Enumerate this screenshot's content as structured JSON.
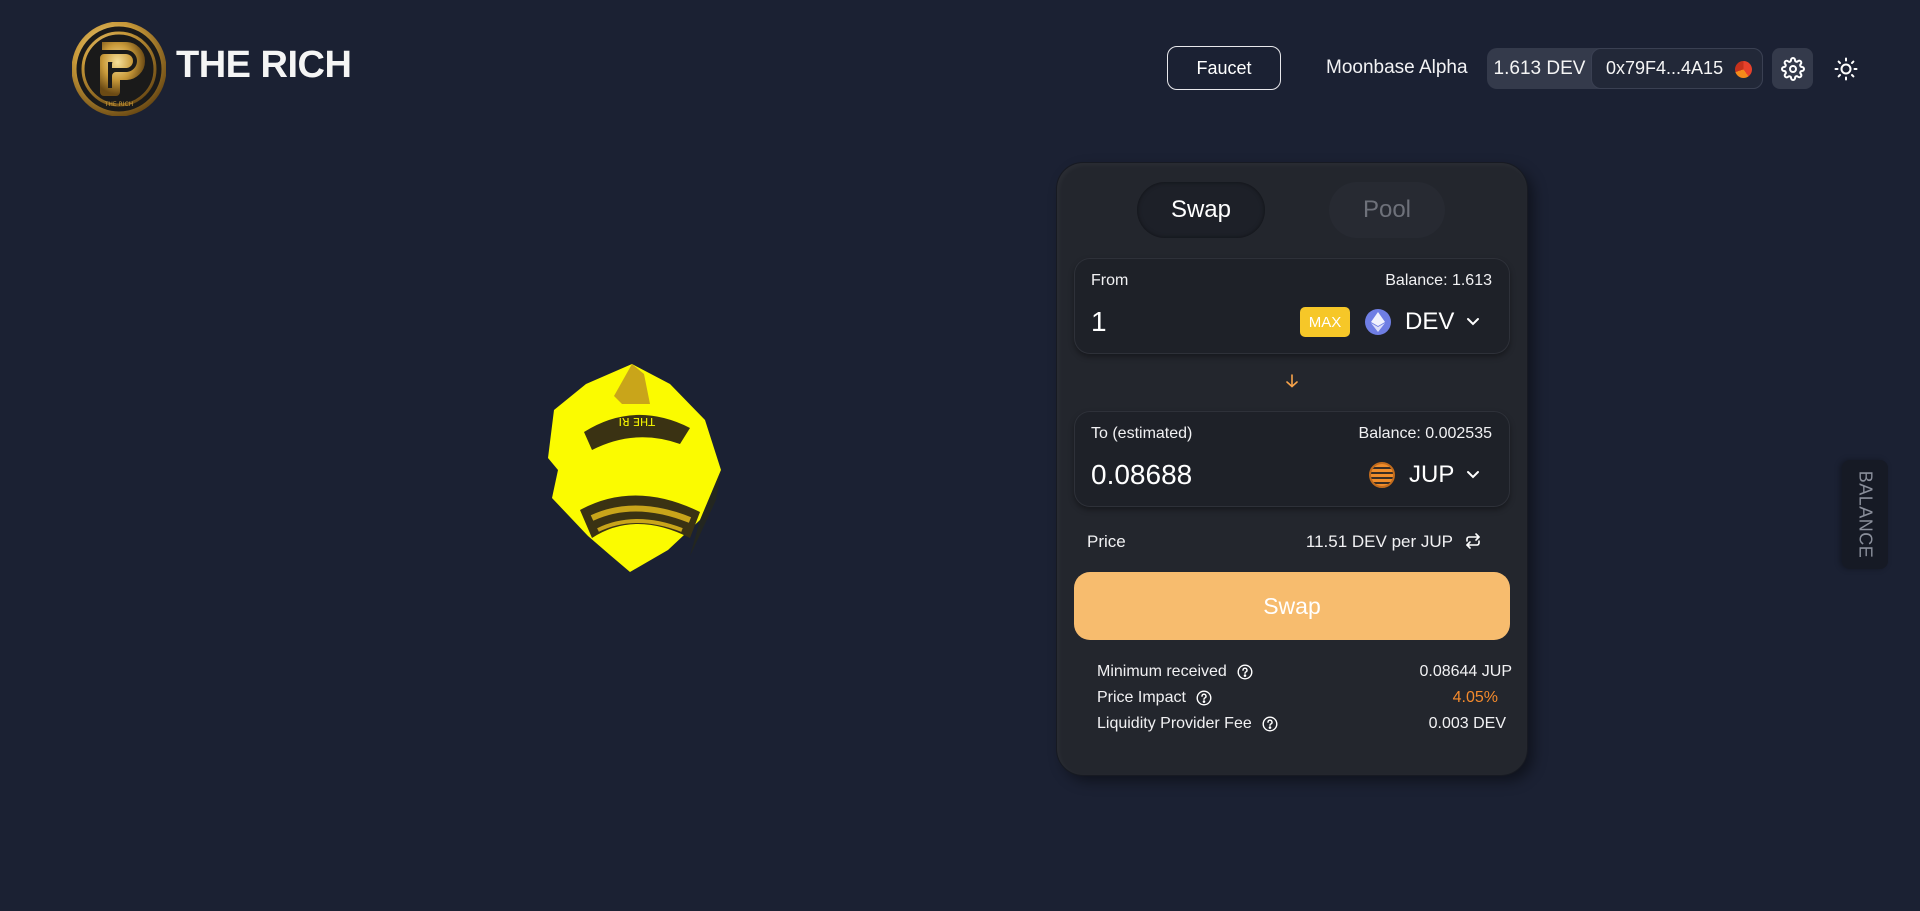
{
  "header": {
    "brand": "THE RICH",
    "logo_text": "THE RICH",
    "faucet_label": "Faucet",
    "network": "Moonbase Alpha",
    "wallet_balance": "1.613 DEV",
    "wallet_address": "0x79F4...4A15",
    "icons": [
      "gear-icon",
      "sun-icon"
    ]
  },
  "coin": {
    "text": "THE RI"
  },
  "swap_card": {
    "tabs": [
      {
        "label": "Swap",
        "active": true
      },
      {
        "label": "Pool",
        "active": false
      }
    ],
    "from": {
      "label": "From",
      "balance": "Balance: 1.613",
      "amount": "1",
      "max_label": "MAX",
      "token": "DEV",
      "token_icon": "eth-icon"
    },
    "to": {
      "label": "To (estimated)",
      "balance": "Balance: 0.002535",
      "amount": "0.08688",
      "token": "JUP",
      "token_icon": "jup-icon"
    },
    "price_label": "Price",
    "price_value": "11.51 DEV per JUP",
    "swap_button": "Swap",
    "details": [
      {
        "label": "Minimum received",
        "value": "0.08644 JUP"
      },
      {
        "label": "Price Impact",
        "value": "4.05%"
      },
      {
        "label": "Liquidity Provider Fee",
        "value": "0.003 DEV"
      }
    ]
  },
  "side_tab": "BALANCE",
  "colors": {
    "background": "#1b2133",
    "card": "#23262d",
    "swap_button": "#f7bc6e",
    "max_button": "#f6c728",
    "price_impact": "#f48a2c"
  }
}
